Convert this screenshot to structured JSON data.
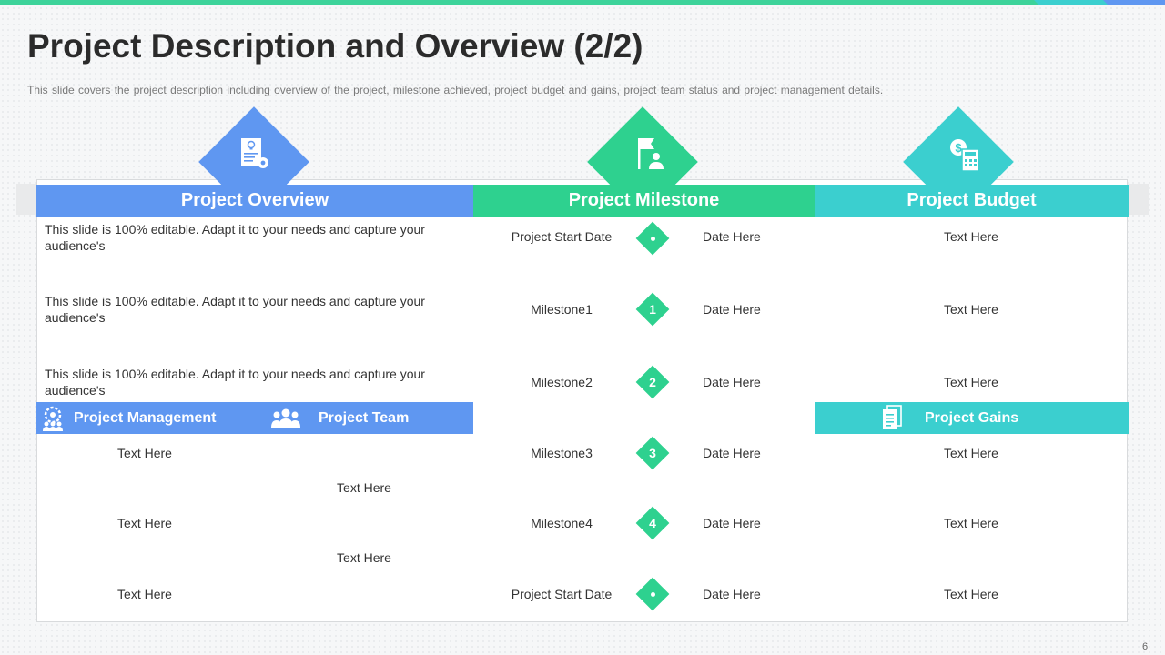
{
  "slide": {
    "title": "Project Description and Overview (2/2)",
    "subtitle": "This slide covers  the project description including overview  of the project, milestone achieved, project budget and gains, project team status and project management details.",
    "page_number": "6"
  },
  "colors": {
    "blue": "#5f97f1",
    "green": "#2ed18f",
    "teal": "#3bcfcf",
    "topbar_green": "#3dd39a"
  },
  "icons": {
    "overview": "idea-document-gear-icon",
    "milestone": "flag-person-icon",
    "budget": "dollar-calculator-icon",
    "management": "gear-people-icon",
    "team": "team-people-icon",
    "gains": "documents-icon"
  },
  "overview": {
    "header": "Project Overview",
    "items": [
      "This slide is 100% editable. Adapt it to your needs and capture your audience's",
      "This slide is 100% editable. Adapt it to your needs and capture your audience's",
      "This slide is 100% editable. Adapt it to your needs and capture your audience's"
    ]
  },
  "milestone": {
    "header": "Project Milestone",
    "rows": [
      {
        "name": "Project Start Date",
        "marker": "",
        "date": "Date Here"
      },
      {
        "name": "Milestone1",
        "marker": "1",
        "date": "Date Here"
      },
      {
        "name": "Milestone2",
        "marker": "2",
        "date": "Date Here"
      },
      {
        "name": "Milestone3",
        "marker": "3",
        "date": "Date Here"
      },
      {
        "name": "Milestone4",
        "marker": "4",
        "date": "Date Here"
      },
      {
        "name": "Project Start Date",
        "marker": "",
        "date": "Date Here"
      }
    ]
  },
  "budget": {
    "header": "Project Budget",
    "items": [
      "Text Here",
      "Text Here",
      "Text Here"
    ]
  },
  "management": {
    "label": "Project Management",
    "items": [
      "Text Here",
      "Text Here",
      "Text Here"
    ]
  },
  "team": {
    "label": "Project Team",
    "items": [
      "Text Here",
      "Text Here"
    ]
  },
  "gains": {
    "label": "Project Gains",
    "items": [
      "Text Here",
      "Text Here",
      "Text Here"
    ]
  }
}
